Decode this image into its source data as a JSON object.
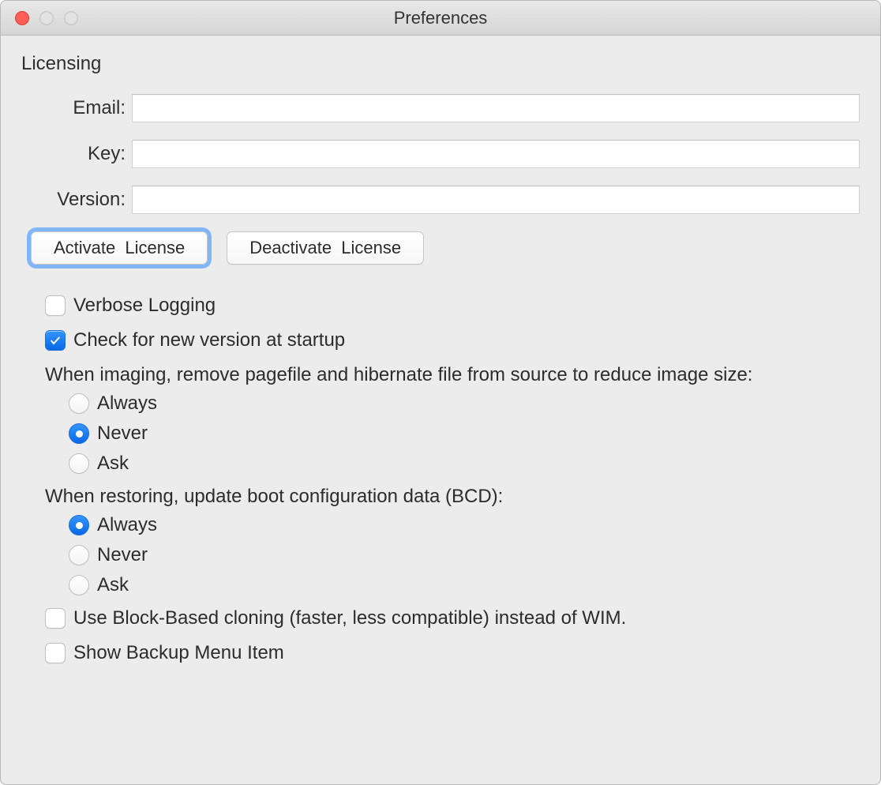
{
  "window": {
    "title": "Preferences"
  },
  "licensing": {
    "section_label": "Licensing",
    "email_label": "Email:",
    "email_value": "",
    "key_label": "Key:",
    "key_value": "",
    "version_label": "Version:",
    "version_value": "",
    "activate_label": "Activate License",
    "deactivate_label": "Deactivate License"
  },
  "options": {
    "verbose_logging": {
      "label": "Verbose Logging",
      "checked": false
    },
    "check_updates": {
      "label": "Check for new version at startup",
      "checked": true
    },
    "imaging_prompt": "When imaging, remove pagefile and hibernate file from source to reduce image size:",
    "imaging_radios": {
      "always": "Always",
      "never": "Never",
      "ask": "Ask",
      "selected": "never"
    },
    "restoring_prompt": "When restoring, update boot configuration data (BCD):",
    "restoring_radios": {
      "always": "Always",
      "never": "Never",
      "ask": "Ask",
      "selected": "always"
    },
    "block_based": {
      "label": "Use Block-Based cloning (faster, less compatible) instead of WIM.",
      "checked": false
    },
    "backup_menu": {
      "label": "Show Backup Menu Item",
      "checked": false
    }
  }
}
